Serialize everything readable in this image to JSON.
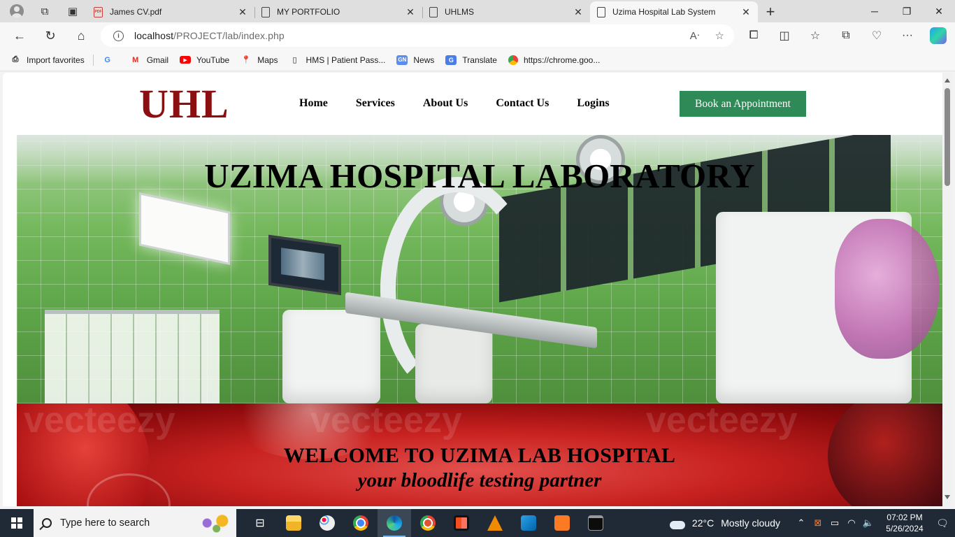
{
  "browser": {
    "tabs": [
      {
        "title": "James CV.pdf",
        "icon": "pdf-icon",
        "active": false
      },
      {
        "title": "MY PORTFOLIO",
        "icon": "page-icon",
        "active": false
      },
      {
        "title": "UHLMS",
        "icon": "page-icon",
        "active": false
      },
      {
        "title": "Uzima Hospital Lab System",
        "icon": "page-icon",
        "active": true
      }
    ],
    "url_host": "localhost",
    "url_path": "/PROJECT/lab/index.php",
    "favorites": [
      {
        "label": "Import favorites",
        "icon": "import-icon"
      },
      {
        "label": "Gmail",
        "icon": "gmail-icon"
      },
      {
        "label": "YouTube",
        "icon": "youtube-icon"
      },
      {
        "label": "Maps",
        "icon": "maps-icon"
      },
      {
        "label": "HMS | Patient Pass...",
        "icon": "page-icon"
      },
      {
        "label": "News",
        "icon": "news-icon"
      },
      {
        "label": "Translate",
        "icon": "translate-icon"
      },
      {
        "label": "https://chrome.goo...",
        "icon": "chrome-icon"
      }
    ]
  },
  "site": {
    "logo": "UHL",
    "nav": [
      "Home",
      "Services",
      "About Us",
      "Contact Us",
      "Logins"
    ],
    "cta": "Book an Appointment",
    "hero_title": "UZIMA HOSPITAL LABORATORY",
    "welcome_title": "WELCOME TO UZIMA LAB HOSPITAL",
    "welcome_subtitle": "your bloodlife testing partner",
    "watermark": "vecteezy",
    "colors": {
      "logo": "#8b0e10",
      "cta_bg": "#2e8b57"
    }
  },
  "taskbar": {
    "search_placeholder": "Type here to search",
    "weather_temp": "22°C",
    "weather_desc": "Mostly cloudy",
    "time": "07:02 PM",
    "date": "5/26/2024"
  }
}
